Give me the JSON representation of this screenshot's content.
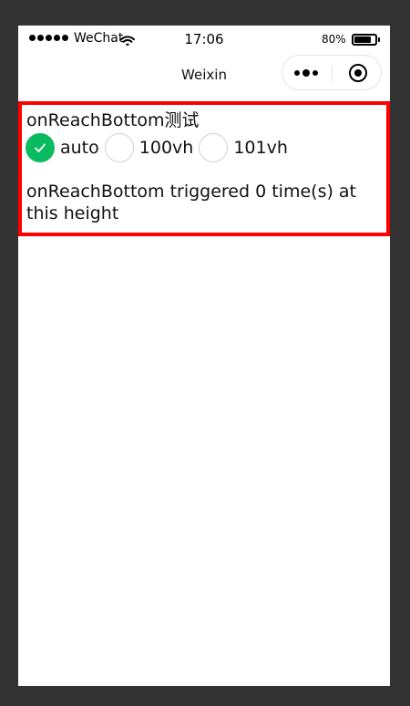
{
  "status_bar": {
    "carrier": "WeChat",
    "time": "17:06",
    "battery": "80%",
    "battery_level": 0.8
  },
  "nav": {
    "title": "Weixin"
  },
  "test": {
    "heading": "onReachBottom测试",
    "options": [
      {
        "label": "auto",
        "checked": true
      },
      {
        "label": "100vh",
        "checked": false
      },
      {
        "label": "101vh",
        "checked": false
      }
    ],
    "result": "onReachBottom triggered 0 time(s) at this height"
  },
  "colors": {
    "accent": "#09bb5f",
    "frame": "#ff0000",
    "outer_background": "#333333"
  },
  "icons": [
    "wifi-icon",
    "battery-icon",
    "more-icon",
    "close-mini-program-icon",
    "checkmark-icon"
  ]
}
